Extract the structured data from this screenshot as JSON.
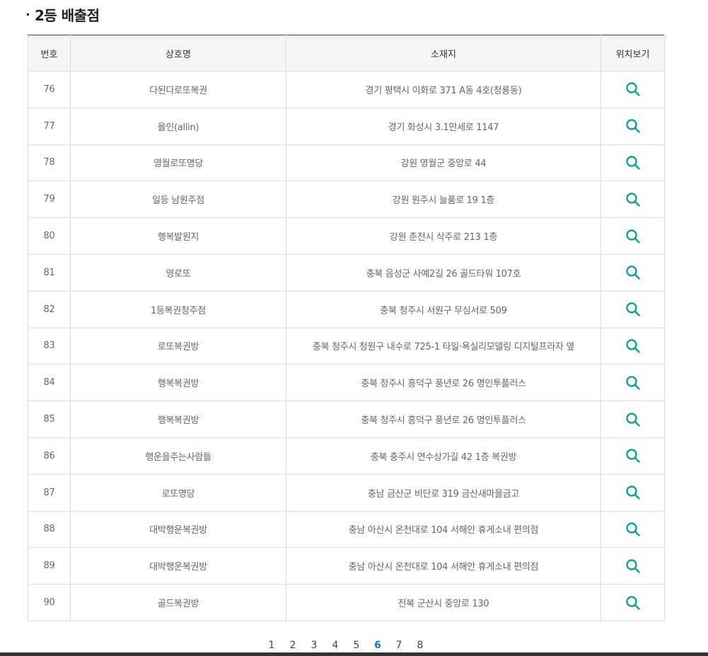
{
  "section": {
    "title": "2등 배출점"
  },
  "table": {
    "headers": {
      "no": "번호",
      "name": "상호명",
      "address": "소재지",
      "location": "위치보기"
    },
    "rows": [
      {
        "no": "76",
        "name": "다된다로또복권",
        "address": "경기 평택시 이화로 371 A동 4호(청룡동)"
      },
      {
        "no": "77",
        "name": "올인(allin)",
        "address": "경기 화성시 3.1만세로 1147"
      },
      {
        "no": "78",
        "name": "영월로또명당",
        "address": "강원 영월군 중앙로 44"
      },
      {
        "no": "79",
        "name": "일등 남원주점",
        "address": "강원 원주시 늘품로 19 1층"
      },
      {
        "no": "80",
        "name": "행복발원지",
        "address": "강원 춘천시 삭주로 213 1층"
      },
      {
        "no": "81",
        "name": "영로또",
        "address": "충북 음성군 사예2길 26 골드타워 107호"
      },
      {
        "no": "82",
        "name": "1등복권청주점",
        "address": "충북 청주시 서원구 무심서로 509"
      },
      {
        "no": "83",
        "name": "로또복권방",
        "address": "충북 청주시 청원구 내수로 725-1 타일·욕실리모델링 디지털프라자 옆"
      },
      {
        "no": "84",
        "name": "행복복권방",
        "address": "충북 청주시 흥덕구 풍년로 26 명인투플러스"
      },
      {
        "no": "85",
        "name": "행복복권방",
        "address": "충북 청주시 흥덕구 풍년로 26 명인투플러스"
      },
      {
        "no": "86",
        "name": "행운을주는사람들",
        "address": "충북 충주시 연수상가길 42 1층 복권방"
      },
      {
        "no": "87",
        "name": "로또명당",
        "address": "충남 금산군 비단로 319 금산새마을금고"
      },
      {
        "no": "88",
        "name": "대박행운복권방",
        "address": "충남 아산시 온천대로 104 서해안 휴게소내 편의점"
      },
      {
        "no": "89",
        "name": "대박행운복권방",
        "address": "충남 아산시 온천대로 104 서해안 휴게소내 편의점"
      },
      {
        "no": "90",
        "name": "골드복권방",
        "address": "전북 군산시 중앙로 130"
      }
    ]
  },
  "pagination": {
    "pages": [
      "1",
      "2",
      "3",
      "4",
      "5",
      "6",
      "7",
      "8"
    ],
    "current": "6"
  },
  "icons": {
    "location": "search-icon"
  },
  "colors": {
    "icon": "#1a9e8f",
    "current_page": "#1a73b8",
    "header_bg": "#f5f5f5",
    "border": "#dddddd"
  }
}
